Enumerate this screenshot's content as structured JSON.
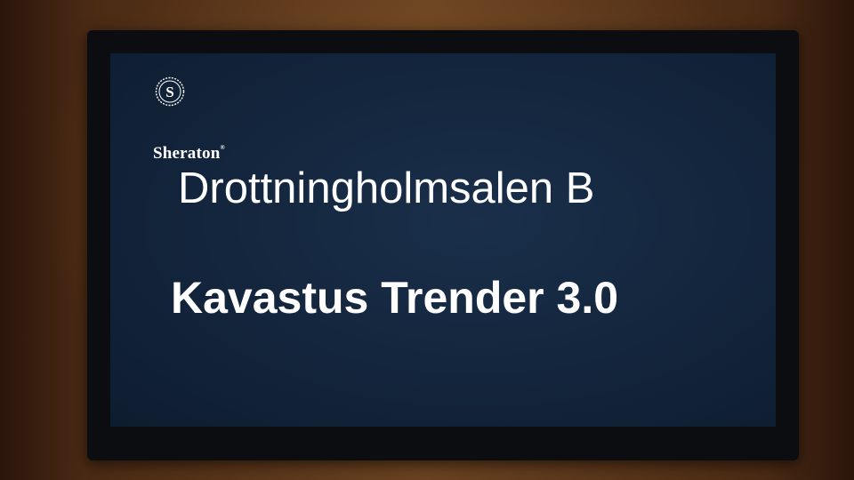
{
  "display": {
    "brand": {
      "name": "Sheraton",
      "emblem": "sheraton-s-emblem",
      "emblem_letter": "S"
    },
    "room_name": "Drottningholmsalen B",
    "event_name": "Kavastus Trender 3.0",
    "colors": {
      "screen_background": "#13253c",
      "text": "#ffffff"
    }
  }
}
